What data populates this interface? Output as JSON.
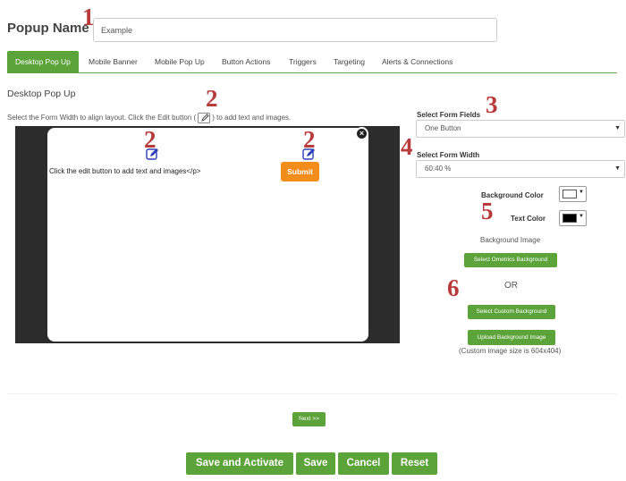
{
  "header": {
    "popup_name_label": "Popup Name",
    "popup_name_value": "Example"
  },
  "tabs": [
    "Desktop Pop Up",
    "Mobile Banner",
    "Mobile Pop Up",
    "Button Actions",
    "Triggers",
    "Targeting",
    "Alerts & Connections"
  ],
  "main": {
    "section_title": "Desktop Pop Up",
    "instruction_before": "Select the Form Width to align layout. Click the Edit button (",
    "instruction_after": ") to add text and images.",
    "popup": {
      "text": "Click the edit button to add text and images</p>",
      "submit_label": "Submit",
      "close_glyph": "×"
    }
  },
  "settings": {
    "form_fields_label": "Select Form Fields",
    "form_fields_value": "One Button",
    "form_width_label": "Select Form Width",
    "form_width_value": "60:40 %",
    "background_color_label": "Background Color",
    "background_color_value": "#ffffff",
    "text_color_label": "Text Color",
    "text_color_value": "#000000",
    "background_image_label": "Background Image",
    "select_ometrics_bg": "Select Ometrics Background",
    "or_text": "OR",
    "select_custom_bg": "Select Custom Background",
    "upload_bg": "Upload Background Image",
    "custom_size_note": "(Custom image size is 604x404)"
  },
  "next_label": "Next >>",
  "footer": {
    "save_activate": "Save and Activate",
    "save": "Save",
    "cancel": "Cancel",
    "reset": "Reset"
  },
  "annotations": [
    "1",
    "2",
    "2",
    "2",
    "3",
    "4",
    "5",
    "6"
  ],
  "colors": {
    "accent": "#5ca33a",
    "submit": "#f28c1a",
    "annotation": "#b83a3a",
    "canvas": "#2c2c2c"
  }
}
